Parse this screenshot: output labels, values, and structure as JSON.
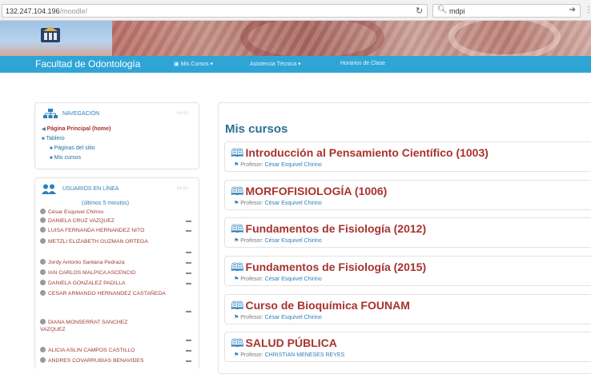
{
  "browser": {
    "url_host": "132.247.104.196",
    "url_path": "/moodle/",
    "search_value": "mdpi"
  },
  "navbar": {
    "brand": "Facultad de Odontología",
    "items": [
      "Mis Cursos ▾",
      "Asistencia Técnica ▾",
      "Horarios de Clase"
    ]
  },
  "nav_block": {
    "title": "NAVEGACIÓN",
    "items": [
      "Página Principal (home)",
      "Tablero",
      "Páginas del sitio",
      "Mis cursos"
    ]
  },
  "users_block": {
    "title": "USUARIOS EN LÍNEA",
    "subtitle": "(últimos 5 minutos)",
    "users": [
      "César Esquivel Chirino",
      "DANIELA CRUZ VAZQUEZ",
      "LUISA FERNANDA HERNANDEZ NITO",
      "METZLI ELIZABETH GUZMAN ORTEGA",
      "Jordy Antonio Santana Pedraza",
      "IAN CARLOS MALPICA ASCENCIO",
      "DANIELA GONZALEZ PADILLA",
      "CESAR ARMANDO HERNANDEZ CASTAÑEDA",
      "DIANA MONSERRAT SANCHEZ VAZQUEZ",
      "ALICIA ASLIN CAMPOS CASTILLO",
      "ANDRES COVARRUBIAS BENAVIDES"
    ]
  },
  "main": {
    "title": "Mis cursos",
    "teacher_label": "Profesor:",
    "courses": [
      {
        "title": "Introducción al Pensamiento Científico (1003)",
        "teacher": "César Esquivel Chirino"
      },
      {
        "title": "MORFOFISIOLOGÍA (1006)",
        "teacher": "César Esquivel Chirino"
      },
      {
        "title": "Fundamentos de Fisiología (2012)",
        "teacher": "César Esquivel Chirino"
      },
      {
        "title": "Fundamentos de Fisiología (2015)",
        "teacher": "César Esquivel Chirino"
      },
      {
        "title": "Curso de Bioquímica FOUNAM",
        "teacher": "César Esquivel Chirino"
      },
      {
        "title": "SALUD PÚBLICA",
        "teacher": "CHRISTIAN MENESES REYES"
      }
    ]
  },
  "colors": {
    "navbar": "#2fa5d6",
    "link_red": "#a8322e",
    "link_blue": "#2f7fb8"
  }
}
